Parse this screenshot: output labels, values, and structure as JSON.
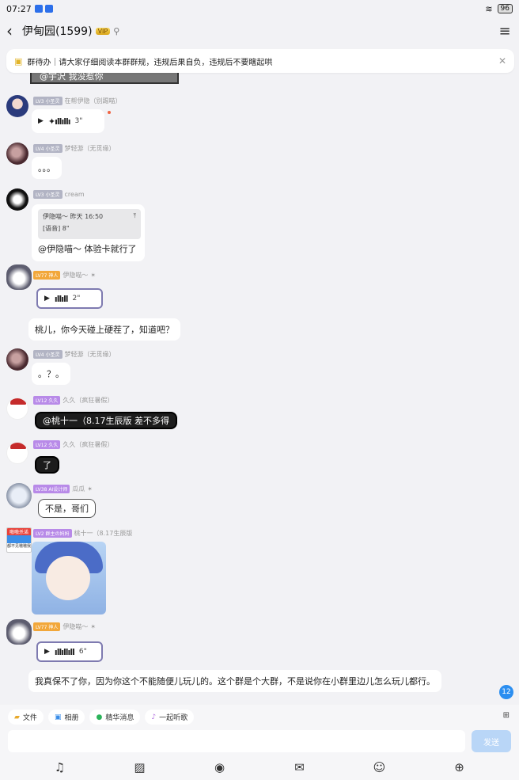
{
  "status_bar": {
    "time": "07:27",
    "battery": "96"
  },
  "header": {
    "title": "伊甸园(1599)",
    "badge": "VIP",
    "pin_icon": "pin-icon",
    "back_icon": "chevron-left-icon",
    "menu_icon": "hamburger-icon"
  },
  "notice": {
    "text": "群待办｜请大家仔细阅读本群群规，违规后果自负，违规后不要瞎起哄",
    "icon": "todo-icon"
  },
  "fragment_text": "@宇沢 我没惹你",
  "messages": [
    {
      "level": "LV3 小圣灵",
      "name": "在帮伊隐（别踢喵）",
      "wave": "✦ıllıllı",
      "duration": "3\""
    },
    {
      "level": "LV4 小圣灵",
      "name": "梦轻游（无觅缘）",
      "text": "。。。"
    },
    {
      "level": "LV3 小圣灵",
      "name": "cream",
      "quote_head": "伊隐喵～ 昨天 16:50",
      "quote_content": "[语音] 8\"",
      "text": "@伊隐喵～ 体验卡就行了"
    },
    {
      "level": "LV77 神人",
      "name": "伊隐喵～",
      "wave": "ıllıll",
      "duration": "2\"",
      "text": "桃儿，你今天碰上硬茬了，知道吧？"
    },
    {
      "level": "LV4 小圣灵",
      "name": "梦轻游（无觅缘）",
      "text": "。？。"
    },
    {
      "level": "LV12 久久",
      "name": "久久（疯狂暑假）",
      "text": "@桃十一（8.17生辰版 差不多得"
    },
    {
      "level": "LV12 久久",
      "name": "久久（疯狂暑假）",
      "text": "了"
    },
    {
      "level": "LV38 AI设计师",
      "name": "瓜瓜",
      "text": "不是，哥们"
    },
    {
      "level": "LV2 群主の妈妈",
      "name": "桃十一（8.17生辰版",
      "avatar_text_top": "嗷嗷杀诺",
      "avatar_text_bottom": "都不见嗷嗷我"
    },
    {
      "level": "LV77 神人",
      "name": "伊隐喵～",
      "wave": "ıllıllıll",
      "duration": "6\"",
      "text": "我真保不了你，因为你这个不能随便儿玩儿的。这个群是个大群，不是说你在小群里边儿怎么玩儿都行。"
    }
  ],
  "unread_count": "12",
  "quick_actions": [
    "文件",
    "相册",
    "精华消息",
    "一起听歌"
  ],
  "send_label": "发送",
  "toolbar_icons": [
    "mic-icon",
    "image-icon",
    "camera-icon",
    "red-packet-icon",
    "emoji-icon",
    "plus-icon"
  ]
}
